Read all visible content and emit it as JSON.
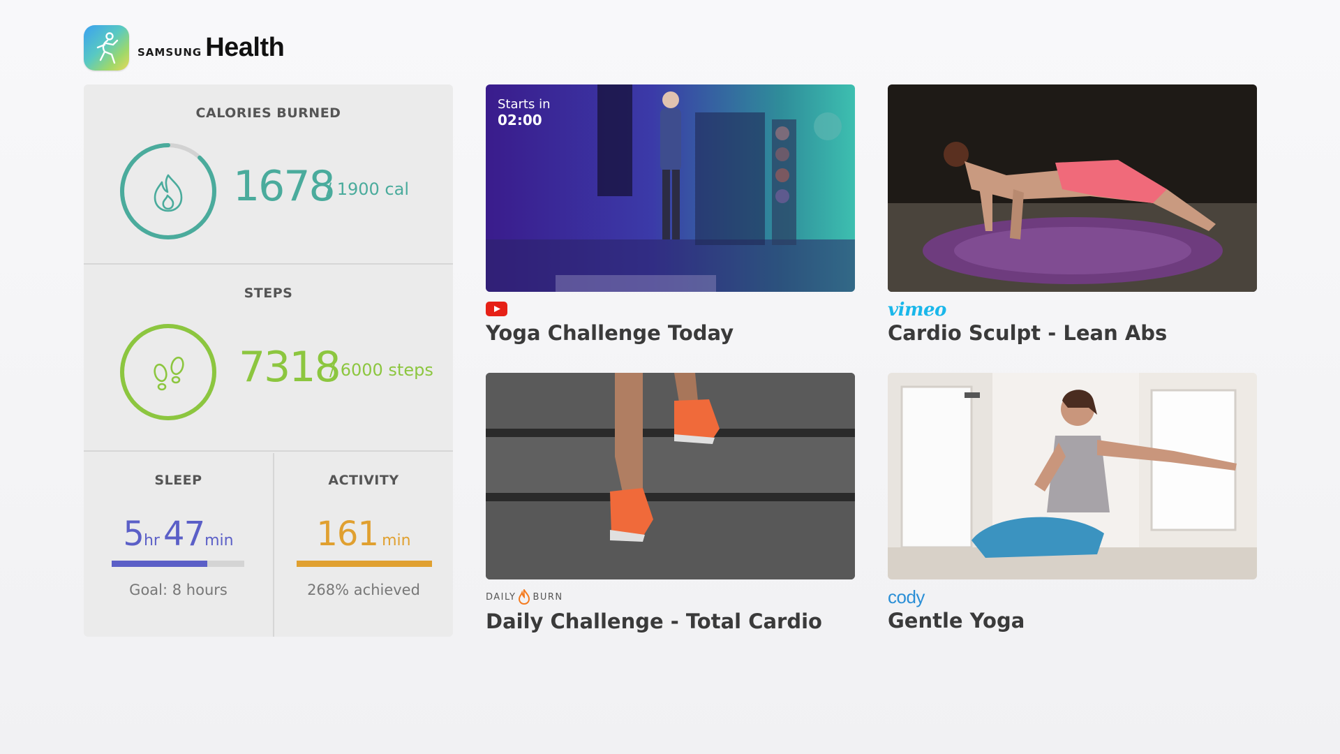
{
  "header": {
    "brand_small": "SAMSUNG",
    "brand_big": "Health",
    "logo_icon": "running-figure-icon"
  },
  "stats": {
    "calories": {
      "title": "CALORIES BURNED",
      "value": "1678",
      "goal": "/ 1900 cal",
      "progress": 0.88,
      "color": "#4aab9c",
      "icon": "flame-icon"
    },
    "steps": {
      "title": "STEPS",
      "value": "7318",
      "goal": "/ 6000 steps",
      "progress": 1.0,
      "color": "#8cc63f",
      "icon": "footprints-icon"
    },
    "sleep": {
      "title": "SLEEP",
      "hours": "5",
      "hours_unit": "hr",
      "minutes": "47",
      "minutes_unit": "min",
      "foot": "Goal: 8 hours",
      "progress": 0.72,
      "color": "#5b5fc7"
    },
    "activity": {
      "title": "ACTIVITY",
      "value": "161",
      "unit": "min",
      "foot": "268% achieved",
      "progress": 1.0,
      "color": "#e0a030"
    }
  },
  "cards": [
    {
      "title": "Yoga Challenge Today",
      "provider": "youtube-icon",
      "starts_label": "Starts in",
      "starts_time": "02:00"
    },
    {
      "title": "Cardio Sculpt - Lean Abs",
      "provider_text": "vimeo",
      "provider": "vimeo-logo"
    },
    {
      "title": "Daily Challenge - Total Cardio",
      "provider_text": "DAILY",
      "provider_text2": "BURN",
      "provider": "dailyburn-logo"
    },
    {
      "title": "Gentle Yoga",
      "provider_text": "cody",
      "provider": "cody-logo"
    }
  ],
  "colors": {
    "youtube": "#e62117",
    "vimeo": "#1ab7ea",
    "cody": "#2b8fd6",
    "dailyburn": "#f47b20"
  }
}
